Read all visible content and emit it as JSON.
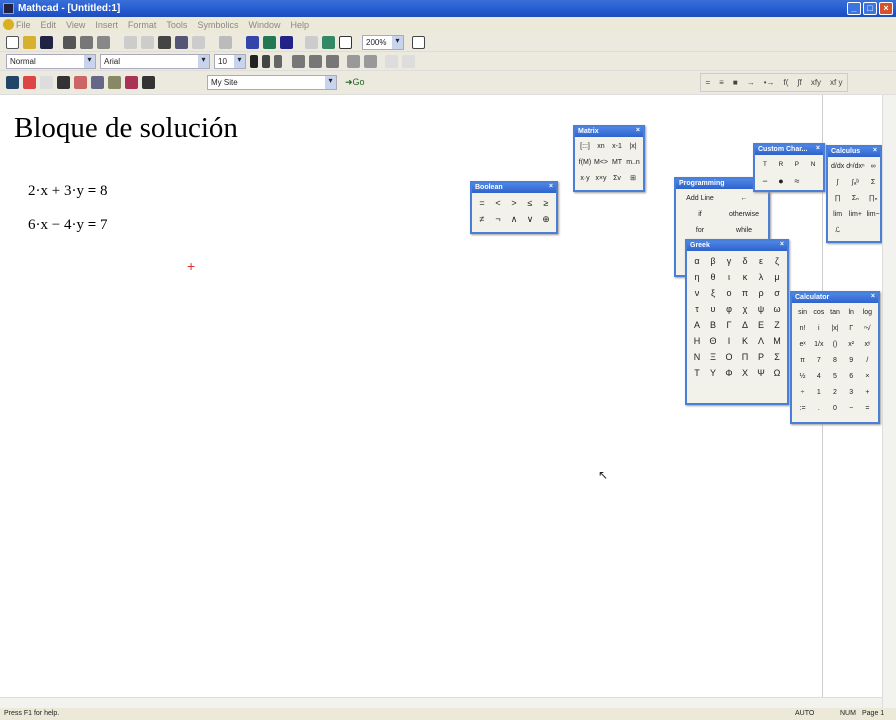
{
  "window": {
    "title": "Mathcad - [Untitled:1]",
    "buttons": [
      "_",
      "□",
      "×"
    ]
  },
  "menu": [
    "File",
    "Edit",
    "View",
    "Insert",
    "Format",
    "Tools",
    "Symbolics",
    "Window",
    "Help"
  ],
  "toolbar": {
    "zoom": "200%",
    "style": "Normal",
    "font": "Arial",
    "size": "10",
    "resource": "My Site",
    "go": "Go"
  },
  "math_toolbar": [
    "=",
    "≡",
    "■",
    "→",
    "•→",
    "f(",
    "∫f",
    "xfy",
    "xf y"
  ],
  "document": {
    "heading": "Bloque de solución",
    "equations": [
      {
        "lhs": "2·x + 3·y",
        "op": "=",
        "rhs": "8"
      },
      {
        "lhs": "6·x − 4·y",
        "op": "=",
        "rhs": "7"
      }
    ]
  },
  "palettes": {
    "boolean": {
      "title": "Boolean",
      "items": [
        "=",
        "<",
        ">",
        "≤",
        "≥",
        "≠",
        "¬",
        "∧",
        "∨",
        "⊕"
      ]
    },
    "matrix": {
      "title": "Matrix",
      "items": [
        "[:::]",
        "xn",
        "x-1",
        "|x|",
        "f(M)",
        "M<>",
        "MT",
        "m..n",
        "x·y",
        "x×y",
        "Σv",
        "⊞"
      ]
    },
    "custom": {
      "title": "Custom Char...",
      "items": [
        "ᵀ",
        "ᴿ",
        "ᴾ",
        "ᴺ",
        "−",
        "●",
        "≈"
      ]
    },
    "calculus": {
      "title": "Calculus",
      "items": [
        "d/dx",
        "dⁿ/dxⁿ",
        "∞",
        "∫",
        "∫ₐᵇ",
        "Σ",
        "∏",
        "Σₙ",
        "∏ₙ",
        "lim",
        "lim+",
        "lim−",
        "ℒ"
      ]
    },
    "programming": {
      "title": "Programming",
      "items": [
        "Add Line",
        "←",
        "if",
        "otherwise",
        "for",
        "while"
      ]
    },
    "greek": {
      "title": "Greek",
      "items": [
        "α",
        "β",
        "γ",
        "δ",
        "ε",
        "ζ",
        "η",
        "θ",
        "ι",
        "κ",
        "λ",
        "μ",
        "ν",
        "ξ",
        "ο",
        "π",
        "ρ",
        "σ",
        "τ",
        "υ",
        "φ",
        "χ",
        "ψ",
        "ω",
        "Α",
        "Β",
        "Γ",
        "Δ",
        "Ε",
        "Ζ",
        "Η",
        "Θ",
        "Ι",
        "Κ",
        "Λ",
        "Μ",
        "Ν",
        "Ξ",
        "Ο",
        "Π",
        "Ρ",
        "Σ",
        "Τ",
        "Υ",
        "Φ",
        "Χ",
        "Ψ",
        "Ω"
      ]
    },
    "calculator": {
      "title": "Calculator",
      "items": [
        "sin",
        "cos",
        "tan",
        "ln",
        "log",
        "n!",
        "i",
        "|x|",
        "Γ",
        "ⁿ√",
        "eˣ",
        "1/x",
        "()",
        "x²",
        "xʸ",
        "π",
        "7",
        "8",
        "9",
        "/",
        "½",
        "4",
        "5",
        "6",
        "×",
        "÷",
        "1",
        "2",
        "3",
        "+",
        ":=",
        ".",
        "0",
        "−",
        "="
      ]
    }
  },
  "status": {
    "help": "Press F1 for help.",
    "mode": "AUTO",
    "num": "NUM",
    "page": "Page 1"
  }
}
